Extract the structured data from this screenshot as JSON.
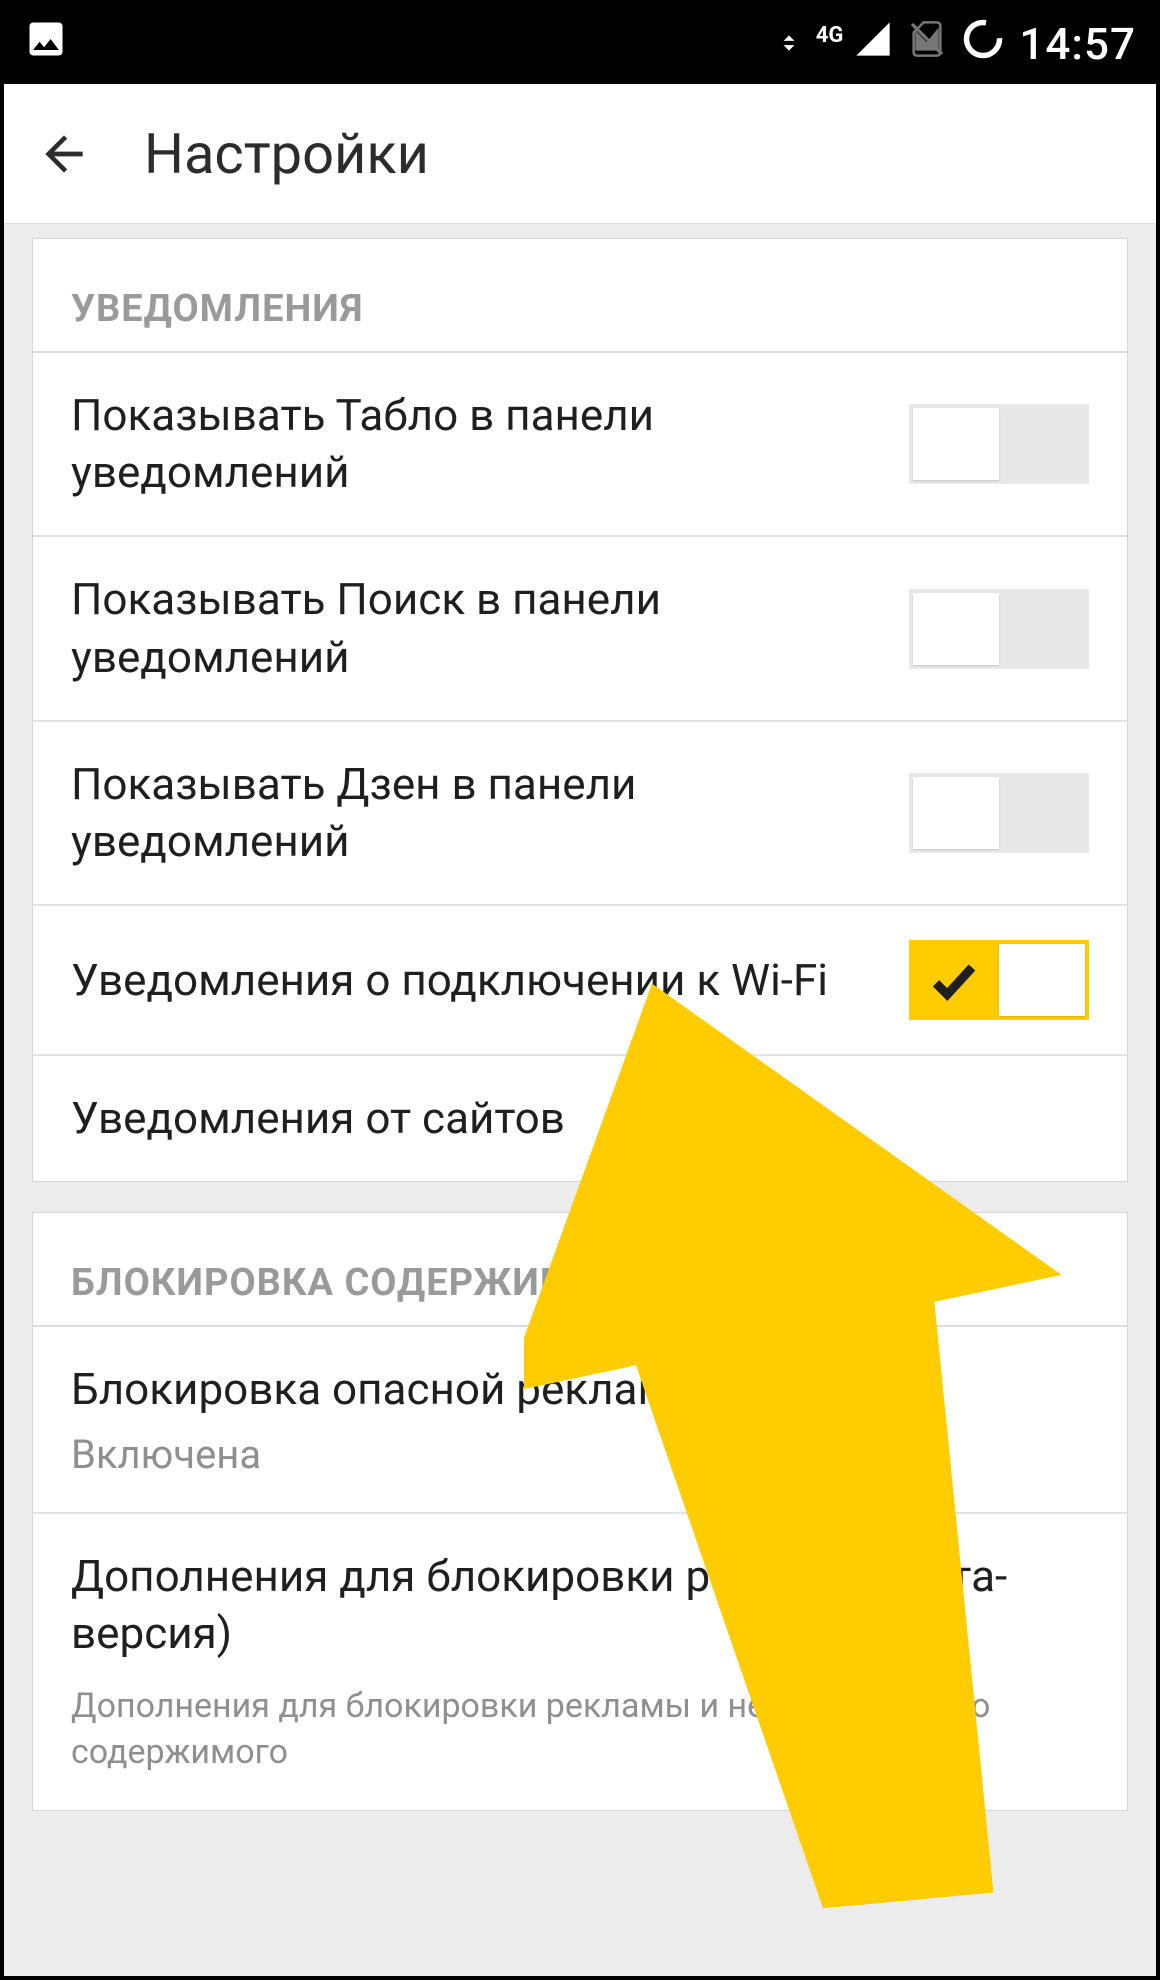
{
  "statusbar": {
    "network_label": "4G",
    "time": "14:57"
  },
  "appbar": {
    "title": "Настройки"
  },
  "sections": {
    "notifications": {
      "header": "УВЕДОМЛЕНИЯ",
      "items": [
        {
          "label": "Показывать Табло в панели уведомлений",
          "toggle": "off"
        },
        {
          "label": "Показывать Поиск в панели уведомлений",
          "toggle": "off"
        },
        {
          "label": "Показывать Дзен в панели уведомлений",
          "toggle": "off"
        },
        {
          "label": "Уведомления о подключении к Wi-Fi",
          "toggle": "on"
        },
        {
          "label": "Уведомления от сайтов"
        }
      ]
    },
    "blocking": {
      "header": "БЛОКИРОВКА СОДЕРЖИМОГО",
      "items": [
        {
          "label": "Блокировка опасной рекламы",
          "sub": "Включена"
        },
        {
          "label": "Дополнения для блокировки рекламы (Бета-версия)",
          "help": "Дополнения для блокировки рекламы и нежелательного содержимого"
        }
      ]
    }
  },
  "overlay": {
    "arrow_color": "#ffcc00"
  }
}
